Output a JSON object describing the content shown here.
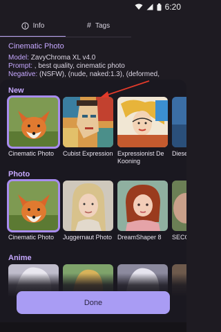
{
  "status": {
    "time": "6:20"
  },
  "tabs": [
    {
      "label": "Info",
      "icon": "info-icon",
      "active": true
    },
    {
      "label": "Tags",
      "icon": "hash-icon",
      "active": false
    }
  ],
  "info": {
    "title": "Cinematic Photo",
    "model_key": "Model:",
    "model_val": " ZavyChroma XL v4.0",
    "prompt_key": "Prompt:",
    "prompt_val": " , best quality, cinematic photo",
    "negative_key": "Negative:",
    "negative_val": " (NSFW), (nude, naked:1.3), (deformed,"
  },
  "sections": {
    "new": {
      "title": "New",
      "cards": [
        {
          "label": "Cinematic Photo",
          "selected": true
        },
        {
          "label": "Cubist Expression",
          "selected": false
        },
        {
          "label": "Expressionist De Kooning",
          "selected": false
        },
        {
          "label": "Diese",
          "selected": false
        }
      ]
    },
    "photo": {
      "title": "Photo",
      "cards": [
        {
          "label": "Cinematic Photo",
          "selected": true
        },
        {
          "label": "Juggernaut Photo",
          "selected": false
        },
        {
          "label": "DreamShaper 8",
          "selected": false
        },
        {
          "label": "SECO",
          "selected": false
        }
      ]
    },
    "anime": {
      "title": "Anime"
    }
  },
  "done_label": "Done",
  "colors": {
    "accent": "#c6a8ff",
    "button": "#a99cf4",
    "background": "#1e1b22"
  }
}
